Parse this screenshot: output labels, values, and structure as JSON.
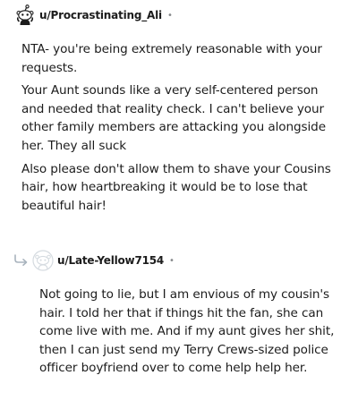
{
  "comments": [
    {
      "username": "u/Procrastinating_Ali",
      "separator": "•",
      "paragraphs": [
        "NTA- you're being extremely reasonable with your requests.",
        "Your Aunt sounds like a very self-centered person and needed that reality check. I can't believe your other family members are attacking you alongside her. They all suck",
        "Also please don't allow them to shave your Cousins hair, how heartbreaking it would be to lose that beautiful hair!"
      ]
    },
    {
      "username": "u/Late-Yellow7154",
      "separator": "•",
      "paragraphs": [
        "Not going to lie, but I am envious of my cousin's hair. I told her that if things hit the fan, she can come live with me. And if my aunt gives her shit, then I can just send my Terry Crews-sized police officer boyfriend over to come help help her."
      ]
    }
  ],
  "icons": {
    "avatar_1": "snoo-avatar-icon",
    "avatar_2": "default-avatar-icon",
    "reply": "reply-arrow-icon"
  },
  "colors": {
    "text": "#1c1c1c",
    "muted": "#878a8c",
    "reply_arrow": "#a8b3bd",
    "avatar_outline": "#d5dbe0"
  }
}
